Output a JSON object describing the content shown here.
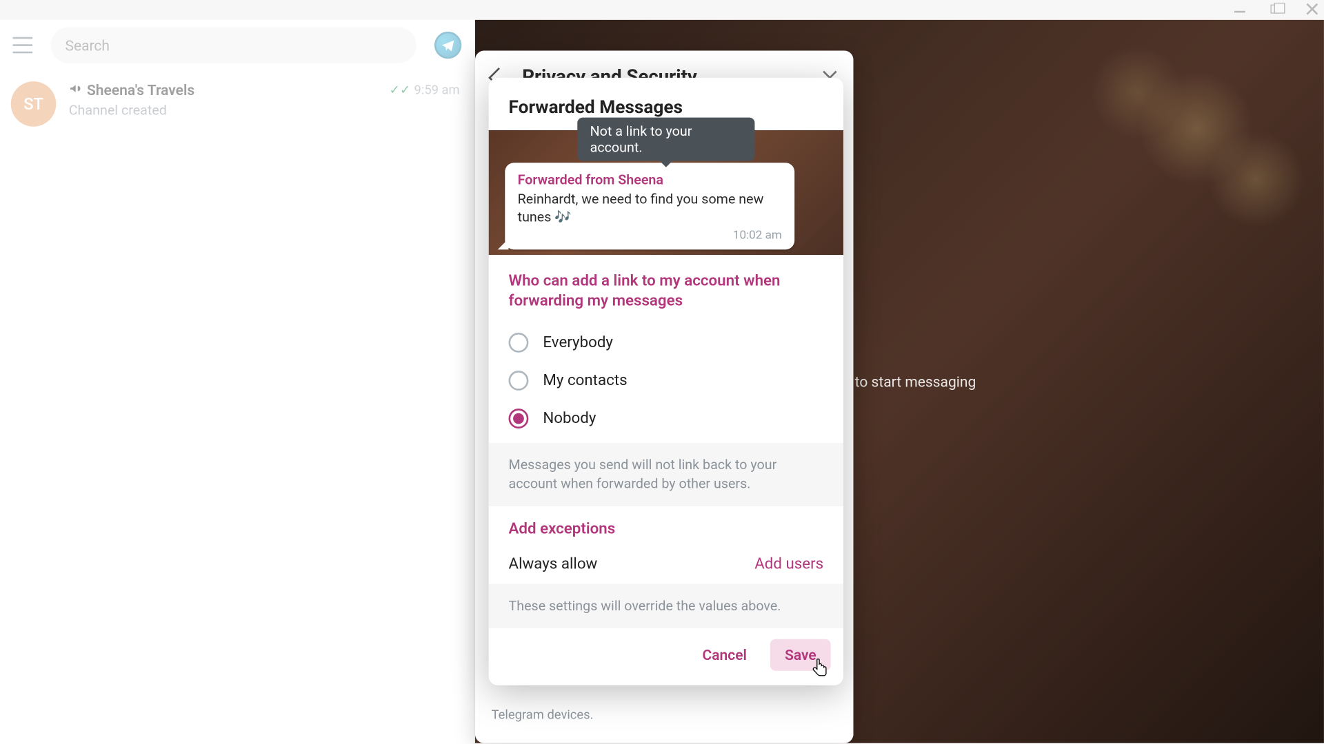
{
  "search": {
    "placeholder": "Search"
  },
  "sidebar": {
    "chats": [
      {
        "avatar_initials": "ST",
        "avatar_color": "#e9a16a",
        "title": "Sheena's Travels",
        "subtitle": "Channel created",
        "time": "9:59 am",
        "delivered": "✓✓"
      }
    ]
  },
  "background_placeholder": "chat to start messaging",
  "settings_modal": {
    "title": "Privacy and Security",
    "footer_text": "Telegram devices."
  },
  "front_modal": {
    "title": "Forwarded Messages",
    "tooltip": "Not a link to your account.",
    "preview": {
      "forwarded_from": "Forwarded from Sheena",
      "text": "Reinhardt, we need to find you some new tunes 🎶",
      "time": "10:02 am"
    },
    "section_title": "Who can add a link to my account when forwarding my messages",
    "options": [
      {
        "label": "Everybody",
        "checked": false
      },
      {
        "label": "My contacts",
        "checked": false
      },
      {
        "label": "Nobody",
        "checked": true
      }
    ],
    "info": "Messages you send will not link back to your account when forwarded by other users.",
    "exceptions_title": "Add exceptions",
    "exceptions_row": {
      "label": "Always allow",
      "link": "Add users"
    },
    "exceptions_info": "These settings will override the values above.",
    "actions": {
      "cancel": "Cancel",
      "save": "Save"
    }
  }
}
